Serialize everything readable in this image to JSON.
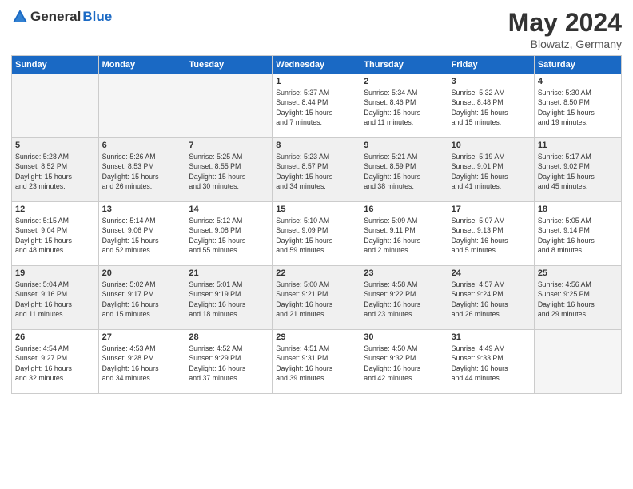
{
  "logo": {
    "general": "General",
    "blue": "Blue"
  },
  "title": {
    "month": "May 2024",
    "location": "Blowatz, Germany"
  },
  "days_of_week": [
    "Sunday",
    "Monday",
    "Tuesday",
    "Wednesday",
    "Thursday",
    "Friday",
    "Saturday"
  ],
  "weeks": [
    [
      {
        "num": "",
        "info": ""
      },
      {
        "num": "",
        "info": ""
      },
      {
        "num": "",
        "info": ""
      },
      {
        "num": "1",
        "info": "Sunrise: 5:37 AM\nSunset: 8:44 PM\nDaylight: 15 hours\nand 7 minutes."
      },
      {
        "num": "2",
        "info": "Sunrise: 5:34 AM\nSunset: 8:46 PM\nDaylight: 15 hours\nand 11 minutes."
      },
      {
        "num": "3",
        "info": "Sunrise: 5:32 AM\nSunset: 8:48 PM\nDaylight: 15 hours\nand 15 minutes."
      },
      {
        "num": "4",
        "info": "Sunrise: 5:30 AM\nSunset: 8:50 PM\nDaylight: 15 hours\nand 19 minutes."
      }
    ],
    [
      {
        "num": "5",
        "info": "Sunrise: 5:28 AM\nSunset: 8:52 PM\nDaylight: 15 hours\nand 23 minutes."
      },
      {
        "num": "6",
        "info": "Sunrise: 5:26 AM\nSunset: 8:53 PM\nDaylight: 15 hours\nand 26 minutes."
      },
      {
        "num": "7",
        "info": "Sunrise: 5:25 AM\nSunset: 8:55 PM\nDaylight: 15 hours\nand 30 minutes."
      },
      {
        "num": "8",
        "info": "Sunrise: 5:23 AM\nSunset: 8:57 PM\nDaylight: 15 hours\nand 34 minutes."
      },
      {
        "num": "9",
        "info": "Sunrise: 5:21 AM\nSunset: 8:59 PM\nDaylight: 15 hours\nand 38 minutes."
      },
      {
        "num": "10",
        "info": "Sunrise: 5:19 AM\nSunset: 9:01 PM\nDaylight: 15 hours\nand 41 minutes."
      },
      {
        "num": "11",
        "info": "Sunrise: 5:17 AM\nSunset: 9:02 PM\nDaylight: 15 hours\nand 45 minutes."
      }
    ],
    [
      {
        "num": "12",
        "info": "Sunrise: 5:15 AM\nSunset: 9:04 PM\nDaylight: 15 hours\nand 48 minutes."
      },
      {
        "num": "13",
        "info": "Sunrise: 5:14 AM\nSunset: 9:06 PM\nDaylight: 15 hours\nand 52 minutes."
      },
      {
        "num": "14",
        "info": "Sunrise: 5:12 AM\nSunset: 9:08 PM\nDaylight: 15 hours\nand 55 minutes."
      },
      {
        "num": "15",
        "info": "Sunrise: 5:10 AM\nSunset: 9:09 PM\nDaylight: 15 hours\nand 59 minutes."
      },
      {
        "num": "16",
        "info": "Sunrise: 5:09 AM\nSunset: 9:11 PM\nDaylight: 16 hours\nand 2 minutes."
      },
      {
        "num": "17",
        "info": "Sunrise: 5:07 AM\nSunset: 9:13 PM\nDaylight: 16 hours\nand 5 minutes."
      },
      {
        "num": "18",
        "info": "Sunrise: 5:05 AM\nSunset: 9:14 PM\nDaylight: 16 hours\nand 8 minutes."
      }
    ],
    [
      {
        "num": "19",
        "info": "Sunrise: 5:04 AM\nSunset: 9:16 PM\nDaylight: 16 hours\nand 11 minutes."
      },
      {
        "num": "20",
        "info": "Sunrise: 5:02 AM\nSunset: 9:17 PM\nDaylight: 16 hours\nand 15 minutes."
      },
      {
        "num": "21",
        "info": "Sunrise: 5:01 AM\nSunset: 9:19 PM\nDaylight: 16 hours\nand 18 minutes."
      },
      {
        "num": "22",
        "info": "Sunrise: 5:00 AM\nSunset: 9:21 PM\nDaylight: 16 hours\nand 21 minutes."
      },
      {
        "num": "23",
        "info": "Sunrise: 4:58 AM\nSunset: 9:22 PM\nDaylight: 16 hours\nand 23 minutes."
      },
      {
        "num": "24",
        "info": "Sunrise: 4:57 AM\nSunset: 9:24 PM\nDaylight: 16 hours\nand 26 minutes."
      },
      {
        "num": "25",
        "info": "Sunrise: 4:56 AM\nSunset: 9:25 PM\nDaylight: 16 hours\nand 29 minutes."
      }
    ],
    [
      {
        "num": "26",
        "info": "Sunrise: 4:54 AM\nSunset: 9:27 PM\nDaylight: 16 hours\nand 32 minutes."
      },
      {
        "num": "27",
        "info": "Sunrise: 4:53 AM\nSunset: 9:28 PM\nDaylight: 16 hours\nand 34 minutes."
      },
      {
        "num": "28",
        "info": "Sunrise: 4:52 AM\nSunset: 9:29 PM\nDaylight: 16 hours\nand 37 minutes."
      },
      {
        "num": "29",
        "info": "Sunrise: 4:51 AM\nSunset: 9:31 PM\nDaylight: 16 hours\nand 39 minutes."
      },
      {
        "num": "30",
        "info": "Sunrise: 4:50 AM\nSunset: 9:32 PM\nDaylight: 16 hours\nand 42 minutes."
      },
      {
        "num": "31",
        "info": "Sunrise: 4:49 AM\nSunset: 9:33 PM\nDaylight: 16 hours\nand 44 minutes."
      },
      {
        "num": "",
        "info": ""
      }
    ]
  ]
}
